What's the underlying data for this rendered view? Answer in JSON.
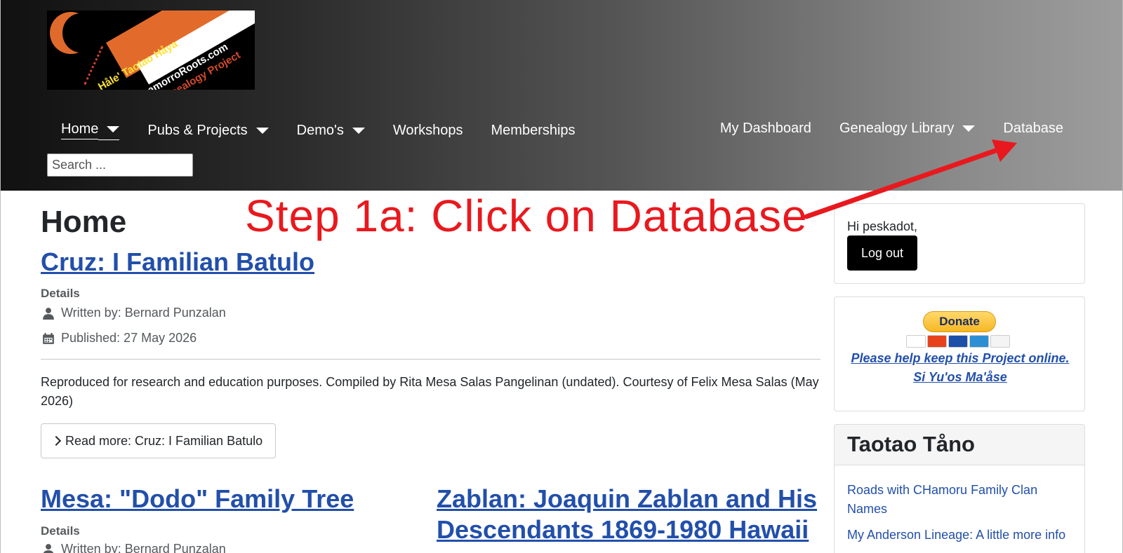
{
  "header": {
    "logo": {
      "alt": "Håle' Taotao Håya ChamorroRoots.com Genealogy Project",
      "line1": "Håle' Taotao Håya",
      "line2": "ChamorroRoots.com",
      "line3": "Genealogy Project"
    },
    "nav_left": [
      {
        "label": "Home",
        "has_dropdown": true,
        "active": true
      },
      {
        "label": "Pubs & Projects",
        "has_dropdown": true
      },
      {
        "label": "Demo's",
        "has_dropdown": true
      },
      {
        "label": "Workshops",
        "has_dropdown": false
      },
      {
        "label": "Memberships",
        "has_dropdown": false
      }
    ],
    "nav_right": [
      {
        "label": "My Dashboard",
        "has_dropdown": false
      },
      {
        "label": "Genealogy Library",
        "has_dropdown": true
      },
      {
        "label": "Database",
        "has_dropdown": false
      }
    ],
    "search": {
      "placeholder": "Search ..."
    }
  },
  "main": {
    "page_title": "Home",
    "articles": [
      {
        "title": "Cruz: I Familian Batulo",
        "details_label": "Details",
        "author": "Written by: Bernard Punzalan",
        "published": "Published: 27 May 2026",
        "intro": "Reproduced for research and education purposes.  Compiled by Rita Mesa Salas Pangelinan (undated). Courtesy of Felix Mesa Salas (May 2026)",
        "read_more": "Read more: Cruz: I Familian Batulo"
      },
      {
        "title": "Mesa: \"Dodo\" Family Tree",
        "details_label": "Details",
        "author": "Written by: Bernard Punzalan"
      },
      {
        "title": "Zablan: Joaquin Zablan and His Descendants 1869-1980 Hawaii"
      }
    ]
  },
  "sidebar": {
    "user": {
      "greeting": "Hi peskadot,",
      "logout": "Log out"
    },
    "donate": {
      "button": "Donate",
      "line1": "Please help keep this Project online.",
      "line2": "Si Yu'os Ma'åse",
      "card_icons": [
        "visa",
        "mastercard",
        "maestro",
        "amex",
        "discover"
      ]
    },
    "taotao_tano": {
      "heading": "Taotao Tåno",
      "links": [
        "Roads with CHamoru Family Clan Names",
        "My Anderson Lineage: A little more info"
      ]
    }
  },
  "annotation": {
    "text": "Step 1a: Click on Database",
    "color": "#e8191e"
  },
  "colors": {
    "link": "#224faa",
    "annotation": "#e8191e",
    "header_dark": "#111111",
    "header_light": "#9d9d9d"
  }
}
